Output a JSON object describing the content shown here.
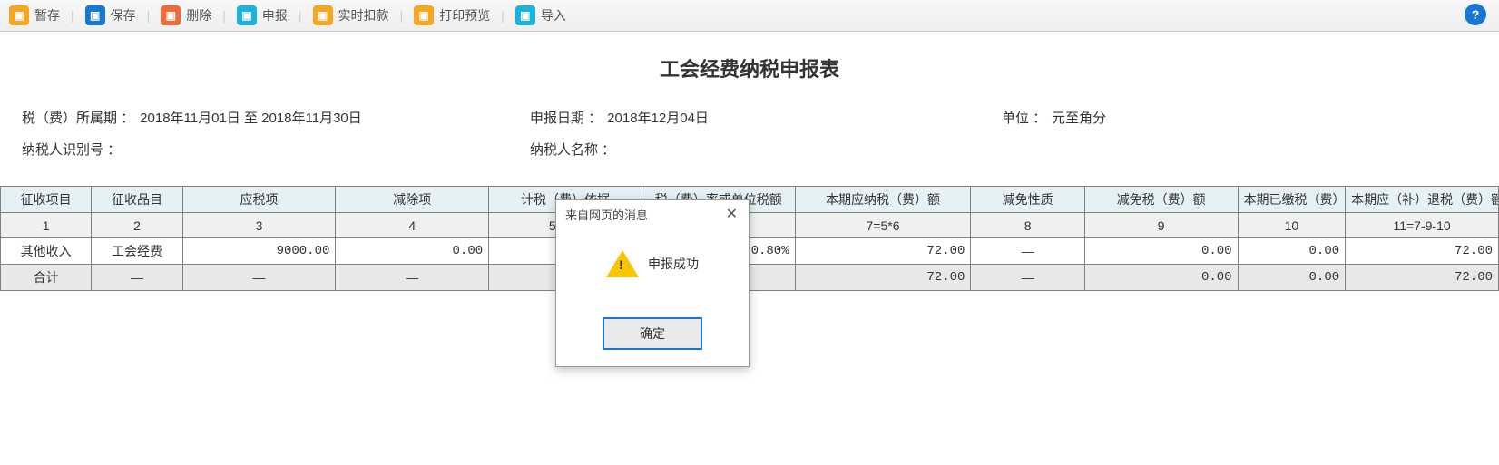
{
  "toolbar": {
    "items": [
      {
        "label": "暂存",
        "icon": "save-draft-icon",
        "bg": "#f5a623"
      },
      {
        "label": "保存",
        "icon": "save-icon",
        "bg": "#1877d2"
      },
      {
        "label": "删除",
        "icon": "delete-icon",
        "bg": "#f06a3a"
      },
      {
        "label": "申报",
        "icon": "declare-icon",
        "bg": "#1cb2e0"
      },
      {
        "label": "实时扣款",
        "icon": "deduct-icon",
        "bg": "#f5a623"
      },
      {
        "label": "打印预览",
        "icon": "print-icon",
        "bg": "#f5a623"
      },
      {
        "label": "导入",
        "icon": "import-icon",
        "bg": "#1cb2e0"
      }
    ],
    "help": "?"
  },
  "title": "工会经费纳税申报表",
  "meta": {
    "period_label": "税（费）所属期 ：",
    "period_value": "2018年11月01日 至 2018年11月30日",
    "declare_date_label": "申报日期 ：",
    "declare_date_value": "2018年12月04日",
    "unit_label": "单位 ：",
    "unit_value": "元至角分",
    "taxpayer_id_label": "纳税人识别号 ：",
    "taxpayer_id_value": "",
    "taxpayer_name_label": "纳税人名称 ：",
    "taxpayer_name_value": ""
  },
  "table": {
    "headers": [
      "征收项目",
      "征收品目",
      "应税项",
      "减除项",
      "计税（费）依据",
      "税（费）率或单位税额",
      "本期应纳税（费）额",
      "减免性质",
      "减免税（费）额",
      "本期已缴税（费）额",
      "本期应（补）退税（费）额"
    ],
    "col_num_row": [
      "1",
      "2",
      "3",
      "4",
      "5=3-4",
      "",
      "7=5*6",
      "8",
      "9",
      "10",
      "11=7-9-10"
    ],
    "rows": [
      {
        "c1": "其他收入",
        "c2": "工会经费",
        "c3": "9000.00",
        "c4": "0.00",
        "c5": "",
        "c6": "0.80%",
        "c7": "72.00",
        "c8": "—",
        "c9": "0.00",
        "c10": "0.00",
        "c11": "72.00"
      }
    ],
    "total": {
      "label": "合计",
      "c2": "—",
      "c3": "—",
      "c4": "—",
      "c5": "",
      "c6": "",
      "c7": "72.00",
      "c8": "—",
      "c9": "0.00",
      "c10": "0.00",
      "c11": "72.00"
    }
  },
  "modal": {
    "title": "来自网页的消息",
    "message": "申报成功",
    "ok": "确定"
  }
}
